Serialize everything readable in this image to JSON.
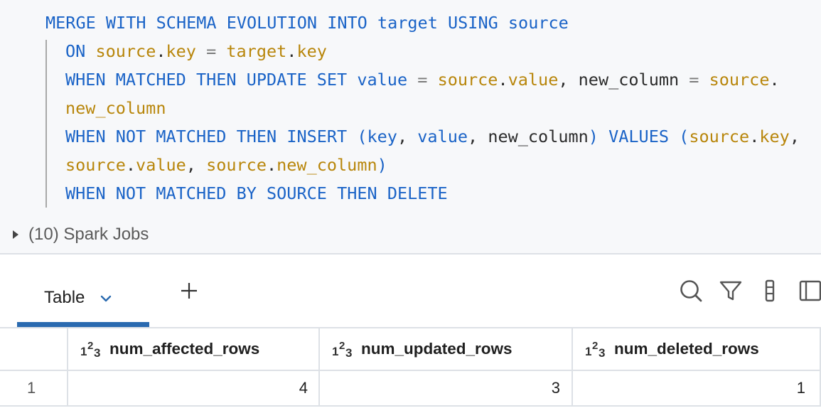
{
  "editor": {
    "code": {
      "l1": {
        "merge": "MERGE",
        "with": "WITH",
        "schema": "SCHEMA",
        "evolution": "EVOLUTION",
        "into": "INTO",
        "target": "target",
        "using": "USING",
        "source": "source"
      },
      "l2": {
        "on": "ON",
        "src": "source",
        "dot": ".",
        "key": "key",
        "eq": " = ",
        "tgt": "target",
        "dot2": ".",
        "key2": "key"
      },
      "l3": {
        "when": "WHEN",
        "matched": "MATCHED",
        "then": "THEN",
        "update": "UPDATE",
        "set": "SET",
        "value": "value",
        "eq": " = ",
        "src": "source",
        "dot": ".",
        "val": "value",
        "comma": ", ",
        "newcol": "new_column",
        "eq2": " = ",
        "src2": "source",
        "dot2": "."
      },
      "l4": {
        "newcol": "new_column"
      },
      "l5": {
        "when": "WHEN",
        "not": "NOT",
        "matched": "MATCHED",
        "then": "THEN",
        "insert": "INSERT",
        "lp": "(",
        "key": "key",
        "c1": ", ",
        "value": "value",
        "c2": ", ",
        "newcol": "new_column",
        "rp": ")",
        "values": "VALUES",
        "lp2": "(",
        "src": "source",
        "dot": ".",
        "key2": "key",
        "c3": ","
      },
      "l6": {
        "src": "source",
        "dot": ".",
        "val": "value",
        "c1": ", ",
        "src2": "source",
        "dot2": ".",
        "newcol": "new_column",
        "rp": ")"
      },
      "l7": {
        "when": "WHEN",
        "not": "NOT",
        "matched": "MATCHED",
        "by": "BY",
        "source": "SOURCE",
        "then": "THEN",
        "delete": "DELETE"
      }
    },
    "spark_jobs_label": "(10) Spark Jobs"
  },
  "results": {
    "active_tab": "Table",
    "tools": [
      "search-icon",
      "filter-icon",
      "column-options-icon",
      "panel-toggle-icon"
    ],
    "type_icon": {
      "one": "1",
      "two": "2",
      "three": "3"
    },
    "columns": [
      "num_affected_rows",
      "num_updated_rows",
      "num_deleted_rows"
    ],
    "rows": [
      {
        "index": "1",
        "values": [
          "4",
          "3",
          "1"
        ]
      }
    ]
  },
  "colors": {
    "keyword": "#1a63c7",
    "identifier": "#b8860b",
    "tab_underline": "#2a6ab0"
  }
}
